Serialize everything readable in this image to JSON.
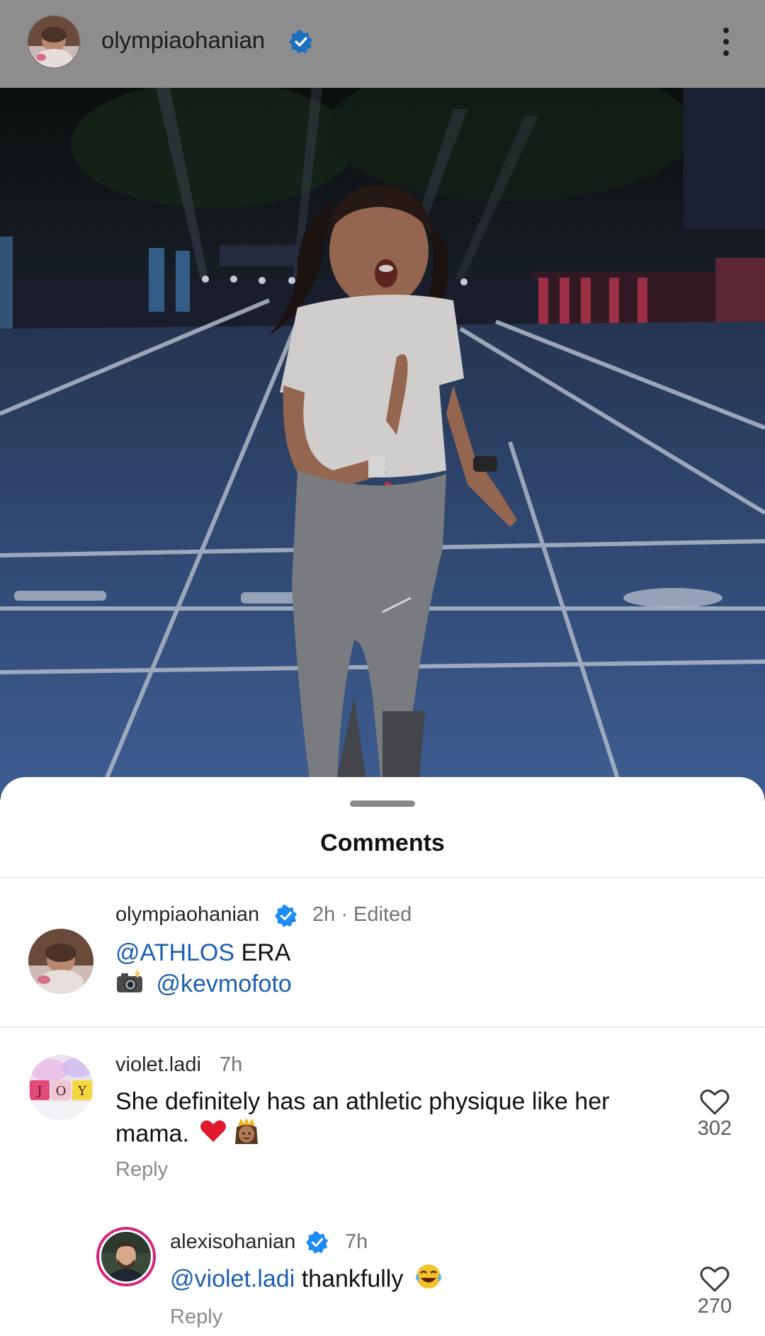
{
  "header": {
    "username": "olympiaohanian"
  },
  "sheet": {
    "title": "Comments"
  },
  "caption": {
    "username": "olympiaohanian",
    "meta": "2h · Edited",
    "mention1": "@ATHLOS",
    "text1": " ERA",
    "mention2": "@kevmofoto"
  },
  "comments": [
    {
      "username": "violet.ladi",
      "time": "7h",
      "text_line1": "She definitely has an athletic physique like her",
      "text_line2": "mama.",
      "reply_label": "Reply",
      "likes": "302",
      "avatar_letters": [
        "J",
        "O",
        "Y"
      ]
    },
    {
      "username": "alexisohanian",
      "time": "7h",
      "mention": "@violet.ladi",
      "text": " thankfully",
      "reply_label": "Reply",
      "likes": "270"
    }
  ],
  "colors": {
    "verified_blue": "#1d8cf0",
    "mention_blue": "#1d5fb0",
    "track_blue": "#3e5c94"
  },
  "icons": {
    "verified": "verified-badge-icon",
    "more": "more-vertical-icon",
    "like": "heart-outline-icon",
    "camera": "camera-flash-emoji"
  }
}
